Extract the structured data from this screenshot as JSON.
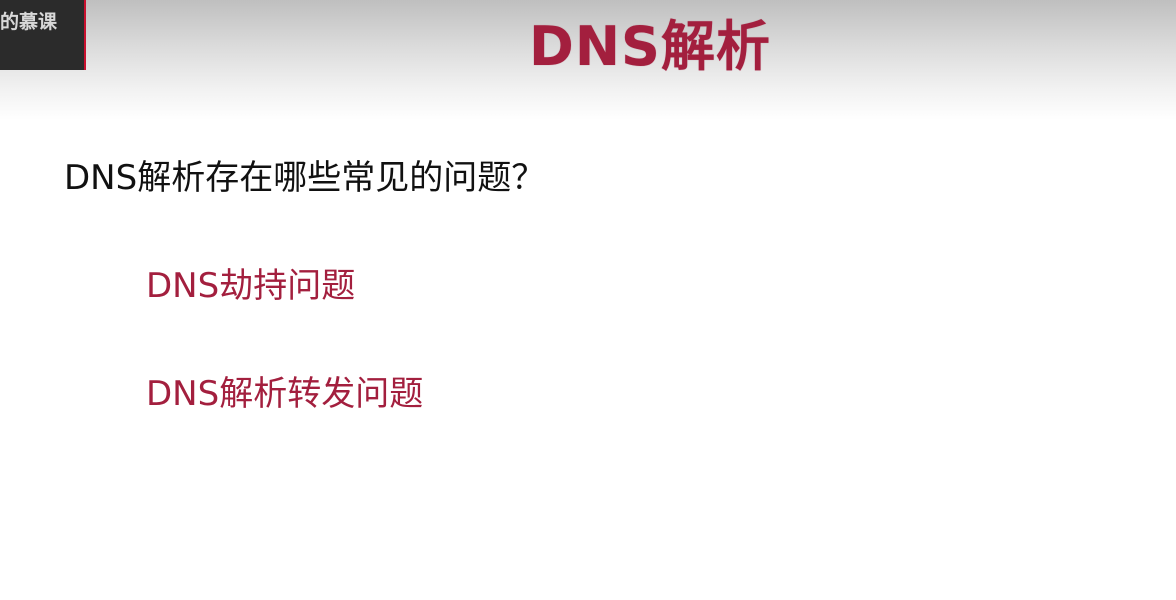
{
  "watermark": {
    "text": "的慕课"
  },
  "slide": {
    "title": "DNS解析",
    "question": "DNS解析存在哪些常见的问题？",
    "points": [
      "DNS劫持问题",
      "DNS解析转发问题"
    ]
  },
  "colors": {
    "accent": "#a31f3e",
    "text": "#111111",
    "header_gradient_top": "#bfbfbf"
  }
}
